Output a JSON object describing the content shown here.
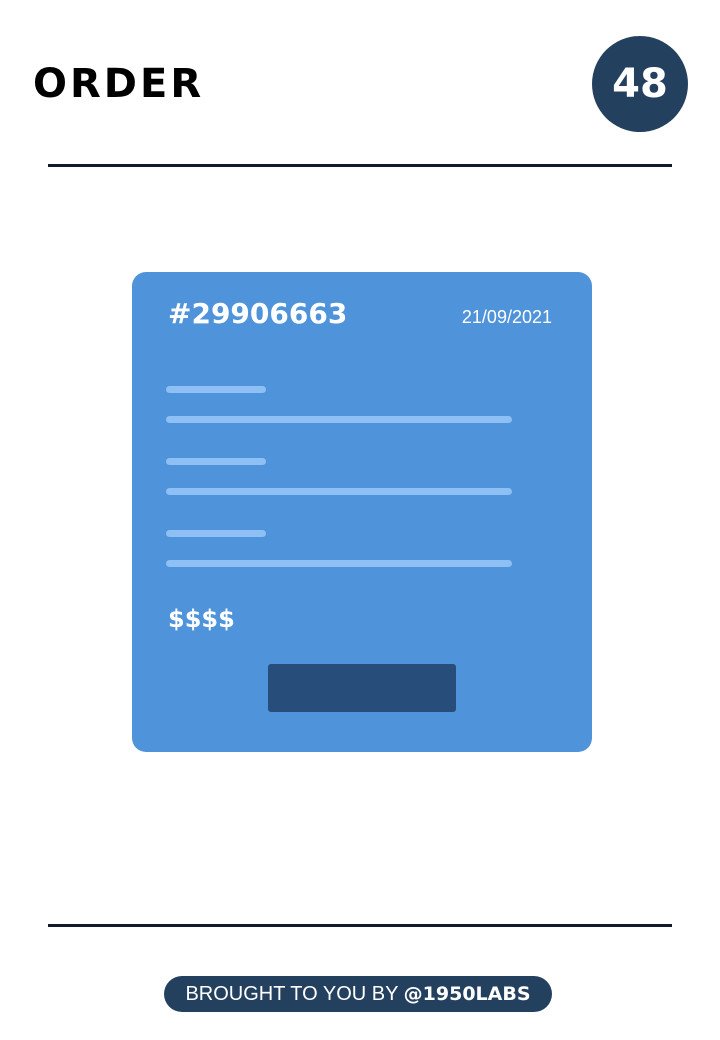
{
  "header": {
    "title": "ORDER",
    "number": "48"
  },
  "card": {
    "order_id": "#29906663",
    "date": "21/09/2021",
    "price": "$$$$"
  },
  "footer": {
    "prefix": "BROUGHT TO YOU BY ",
    "handle": "@1950LABS"
  },
  "colors": {
    "card": "#4f93da",
    "card_lines": "#8ec0f5",
    "button": "#274e7a",
    "badge": "#24405f",
    "divider": "#0f1b2b"
  }
}
